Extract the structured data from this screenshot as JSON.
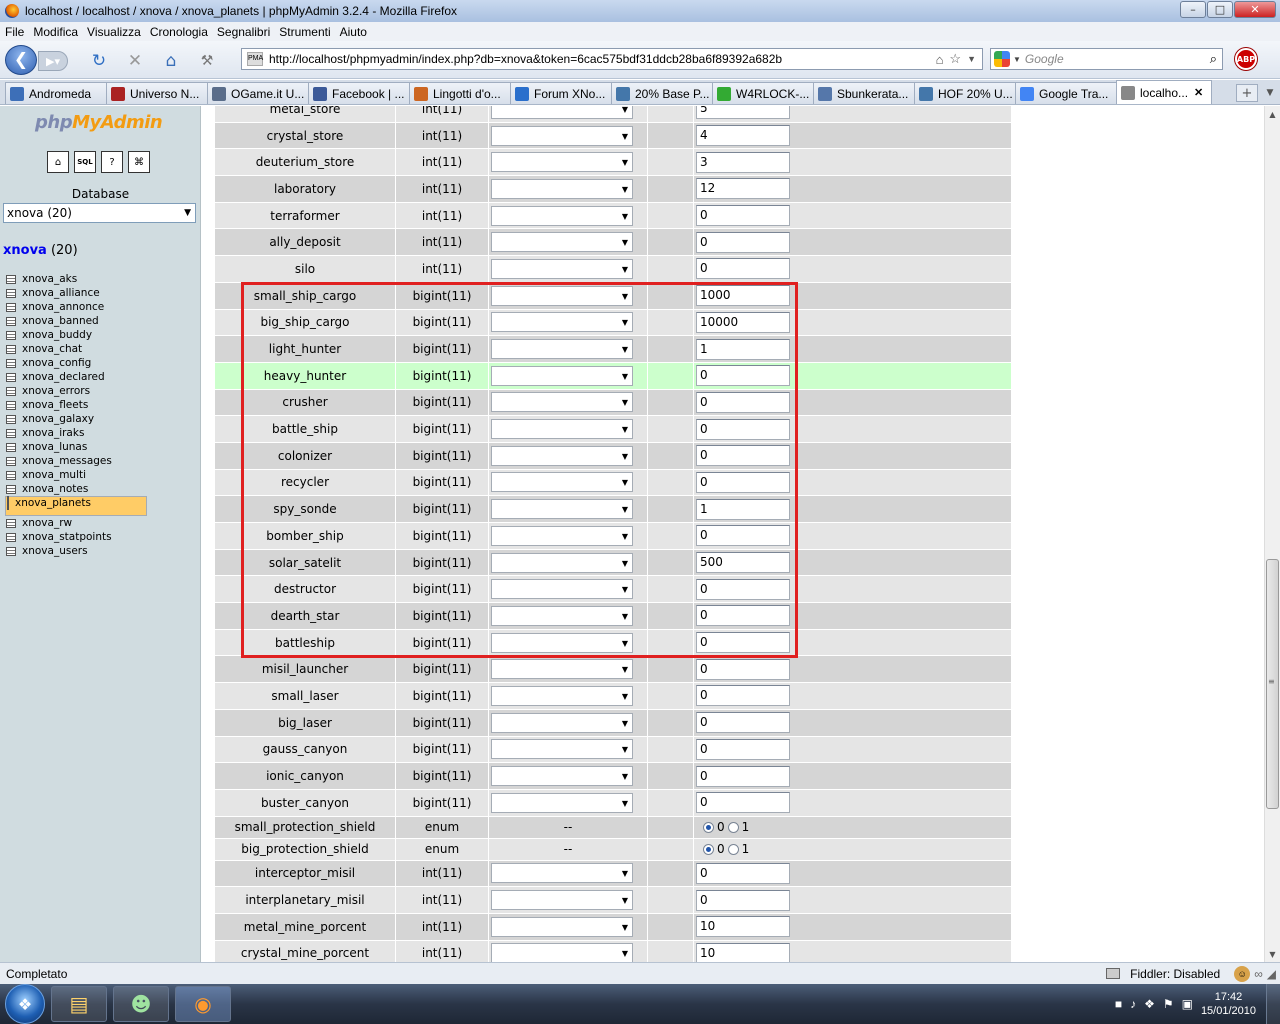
{
  "window": {
    "title": "localhost / localhost / xnova / xnova_planets | phpMyAdmin 3.2.4 - Mozilla Firefox",
    "min_label": "–",
    "max_label": "□",
    "close_label": "✕"
  },
  "menu": [
    "File",
    "Modifica",
    "Visualizza",
    "Cronologia",
    "Segnalibri",
    "Strumenti",
    "Aiuto"
  ],
  "nav": {
    "url": "http://localhost/phpmyadmin/index.php?db=xnova&token=6cac575bdf31ddcb28ba6f89392a682b",
    "search_placeholder": "Google",
    "abp_label": "ABP"
  },
  "tabs": [
    {
      "label": "Andromeda",
      "color": "#3d6fb8"
    },
    {
      "label": "Universo N...",
      "color": "#aa2222"
    },
    {
      "label": "OGame.it U...",
      "color": "#5a6d8a"
    },
    {
      "label": "Facebook | ...",
      "color": "#3b5998"
    },
    {
      "label": "Lingotti d'o...",
      "color": "#cc6622"
    },
    {
      "label": "Forum XNo...",
      "color": "#2a6fcc"
    },
    {
      "label": "20% Base P...",
      "color": "#4477aa"
    },
    {
      "label": "W4RLOCK-...",
      "color": "#33aa33"
    },
    {
      "label": "Sbunkerata...",
      "color": "#5577aa"
    },
    {
      "label": "HOF 20% U...",
      "color": "#4477aa"
    },
    {
      "label": "Google Tra...",
      "color": "#4285f4"
    },
    {
      "label": "localho...",
      "color": "#888888"
    }
  ],
  "tab_close": "✕",
  "sidebar": {
    "logo_a": "php",
    "logo_b": "MyAdmin",
    "database_label": "Database",
    "db_select": "xnova (20)",
    "db_name": "xnova",
    "db_count": " (20)",
    "tables": [
      "xnova_aks",
      "xnova_alliance",
      "xnova_annonce",
      "xnova_banned",
      "xnova_buddy",
      "xnova_chat",
      "xnova_config",
      "xnova_declared",
      "xnova_errors",
      "xnova_fleets",
      "xnova_galaxy",
      "xnova_iraks",
      "xnova_lunas",
      "xnova_messages",
      "xnova_multi",
      "xnova_notes",
      "xnova_planets",
      "xnova_rw",
      "xnova_statpoints",
      "xnova_users"
    ],
    "selected": "xnova_planets"
  },
  "rows": [
    {
      "name": "metal_store",
      "type": "int(11)",
      "value": "5"
    },
    {
      "name": "crystal_store",
      "type": "int(11)",
      "value": "4"
    },
    {
      "name": "deuterium_store",
      "type": "int(11)",
      "value": "3"
    },
    {
      "name": "laboratory",
      "type": "int(11)",
      "value": "12"
    },
    {
      "name": "terraformer",
      "type": "int(11)",
      "value": "0"
    },
    {
      "name": "ally_deposit",
      "type": "int(11)",
      "value": "0"
    },
    {
      "name": "silo",
      "type": "int(11)",
      "value": "0"
    },
    {
      "name": "small_ship_cargo",
      "type": "bigint(11)",
      "value": "1000"
    },
    {
      "name": "big_ship_cargo",
      "type": "bigint(11)",
      "value": "10000"
    },
    {
      "name": "light_hunter",
      "type": "bigint(11)",
      "value": "1"
    },
    {
      "name": "heavy_hunter",
      "type": "bigint(11)",
      "value": "0",
      "highlight": true
    },
    {
      "name": "crusher",
      "type": "bigint(11)",
      "value": "0"
    },
    {
      "name": "battle_ship",
      "type": "bigint(11)",
      "value": "0"
    },
    {
      "name": "colonizer",
      "type": "bigint(11)",
      "value": "0"
    },
    {
      "name": "recycler",
      "type": "bigint(11)",
      "value": "0"
    },
    {
      "name": "spy_sonde",
      "type": "bigint(11)",
      "value": "1"
    },
    {
      "name": "bomber_ship",
      "type": "bigint(11)",
      "value": "0"
    },
    {
      "name": "solar_satelit",
      "type": "bigint(11)",
      "value": "500"
    },
    {
      "name": "destructor",
      "type": "bigint(11)",
      "value": "0"
    },
    {
      "name": "dearth_star",
      "type": "bigint(11)",
      "value": "0"
    },
    {
      "name": "battleship",
      "type": "bigint(11)",
      "value": "0"
    },
    {
      "name": "misil_launcher",
      "type": "bigint(11)",
      "value": "0"
    },
    {
      "name": "small_laser",
      "type": "bigint(11)",
      "value": "0"
    },
    {
      "name": "big_laser",
      "type": "bigint(11)",
      "value": "0"
    },
    {
      "name": "gauss_canyon",
      "type": "bigint(11)",
      "value": "0"
    },
    {
      "name": "ionic_canyon",
      "type": "bigint(11)",
      "value": "0"
    },
    {
      "name": "buster_canyon",
      "type": "bigint(11)",
      "value": "0"
    },
    {
      "name": "small_protection_shield",
      "type": "enum",
      "enum": true,
      "func": "--",
      "opt0": "0",
      "opt1": "1"
    },
    {
      "name": "big_protection_shield",
      "type": "enum",
      "enum": true,
      "func": "--",
      "opt0": "0",
      "opt1": "1"
    },
    {
      "name": "interceptor_misil",
      "type": "int(11)",
      "value": "0"
    },
    {
      "name": "interplanetary_misil",
      "type": "int(11)",
      "value": "0"
    },
    {
      "name": "metal_mine_porcent",
      "type": "int(11)",
      "value": "10"
    },
    {
      "name": "crystal_mine_porcent",
      "type": "int(11)",
      "value": "10"
    }
  ],
  "status": {
    "text": "Completato",
    "fiddler": "Fiddler: Disabled"
  },
  "tray": {
    "time": "17:42",
    "date": "15/01/2010"
  }
}
